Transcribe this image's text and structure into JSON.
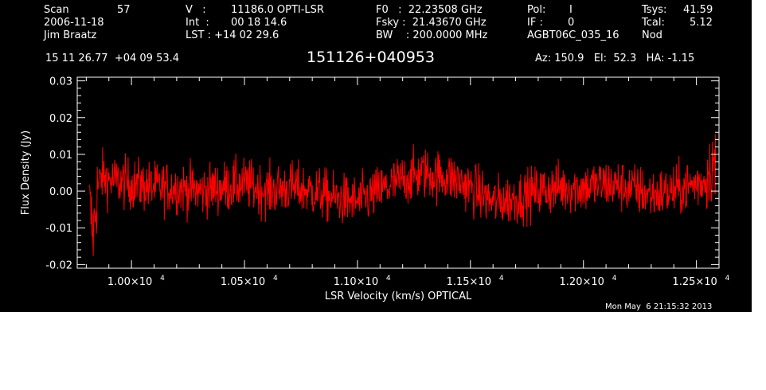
{
  "header": {
    "col1": [
      "Scan",
      "2006-11-18",
      "Jim Braatz"
    ],
    "scan_number": "57",
    "col2": [
      "V   :",
      "Int  :",
      "LST : +14 02 29.6"
    ],
    "col2_values": [
      "11186.0 OPTI-LSR",
      "00 18 14.6"
    ],
    "col3": [
      "F0   :  22.23508 GHz",
      "Fsky :  21.43670 GHz",
      "BW    : 200.0000 MHz"
    ],
    "col4": [
      "Pol:",
      "IF :",
      "AGBT06C_035_16"
    ],
    "col4_values": [
      "I",
      "0",
      "Nod"
    ],
    "col5": [
      "Tsys:",
      "Tcal:"
    ],
    "col5_values": [
      "41.59",
      "5.12"
    ],
    "coords": "15 11 26.77  +04 09 53.4",
    "source": "151126+040953",
    "pointing": "Az: 150.9   El:  52.3   HA: -1.15",
    "timestamp": "Mon May  6 21:15:32 2013"
  },
  "colors": {
    "background": "#000000",
    "axes": "#ffffff",
    "trace": "#ff0000"
  },
  "chart_data": {
    "type": "line",
    "xlabel": "LSR Velocity (km/s) OPTICAL",
    "ylabel": "Flux Density (Jy)",
    "xlim": [
      9760,
      12600
    ],
    "ylim": [
      -0.021,
      0.031
    ],
    "x_ticks": [
      10000,
      10500,
      11000,
      11500,
      12000,
      12500
    ],
    "x_tick_labels": [
      {
        "mant": "1.00×10",
        "exp": "4"
      },
      {
        "mant": "1.05×10",
        "exp": "4"
      },
      {
        "mant": "1.10×10",
        "exp": "4"
      },
      {
        "mant": "1.15×10",
        "exp": "4"
      },
      {
        "mant": "1.20×10",
        "exp": "4"
      },
      {
        "mant": "1.25×10",
        "exp": "4"
      }
    ],
    "y_ticks": [
      -0.02,
      -0.01,
      0.0,
      0.01,
      0.02,
      0.03
    ],
    "y_tick_labels": [
      "-0.02",
      "-0.01",
      "0.00",
      "0.01",
      "0.02",
      "0.03"
    ],
    "series": [
      {
        "color": "#ff0000",
        "x": [
          9815,
          9830,
          9850,
          9870,
          9900,
          10000,
          10100,
          10200,
          10300,
          10400,
          10500,
          10600,
          10700,
          10800,
          10900,
          11000,
          11100,
          11200,
          11300,
          11350,
          11400,
          11500,
          11600,
          11700,
          11800,
          11900,
          12000,
          12100,
          12200,
          12300,
          12400,
          12450,
          12500,
          12540,
          12560,
          12575,
          12585
        ],
        "y": [
          -0.004,
          -0.012,
          0.001,
          0.004,
          0.003,
          0.002,
          0.001,
          0.001,
          0.0,
          0.001,
          0.002,
          0.0,
          0.001,
          0.0,
          -0.002,
          -0.003,
          0.0,
          0.003,
          0.005,
          0.004,
          0.004,
          0.001,
          -0.003,
          -0.002,
          0.0,
          0.001,
          0.001,
          0.002,
          0.001,
          -0.001,
          0.0,
          0.001,
          0.002,
          0.003,
          0.006,
          0.008,
          0.006
        ],
        "noise_rms": 0.0035
      }
    ]
  }
}
